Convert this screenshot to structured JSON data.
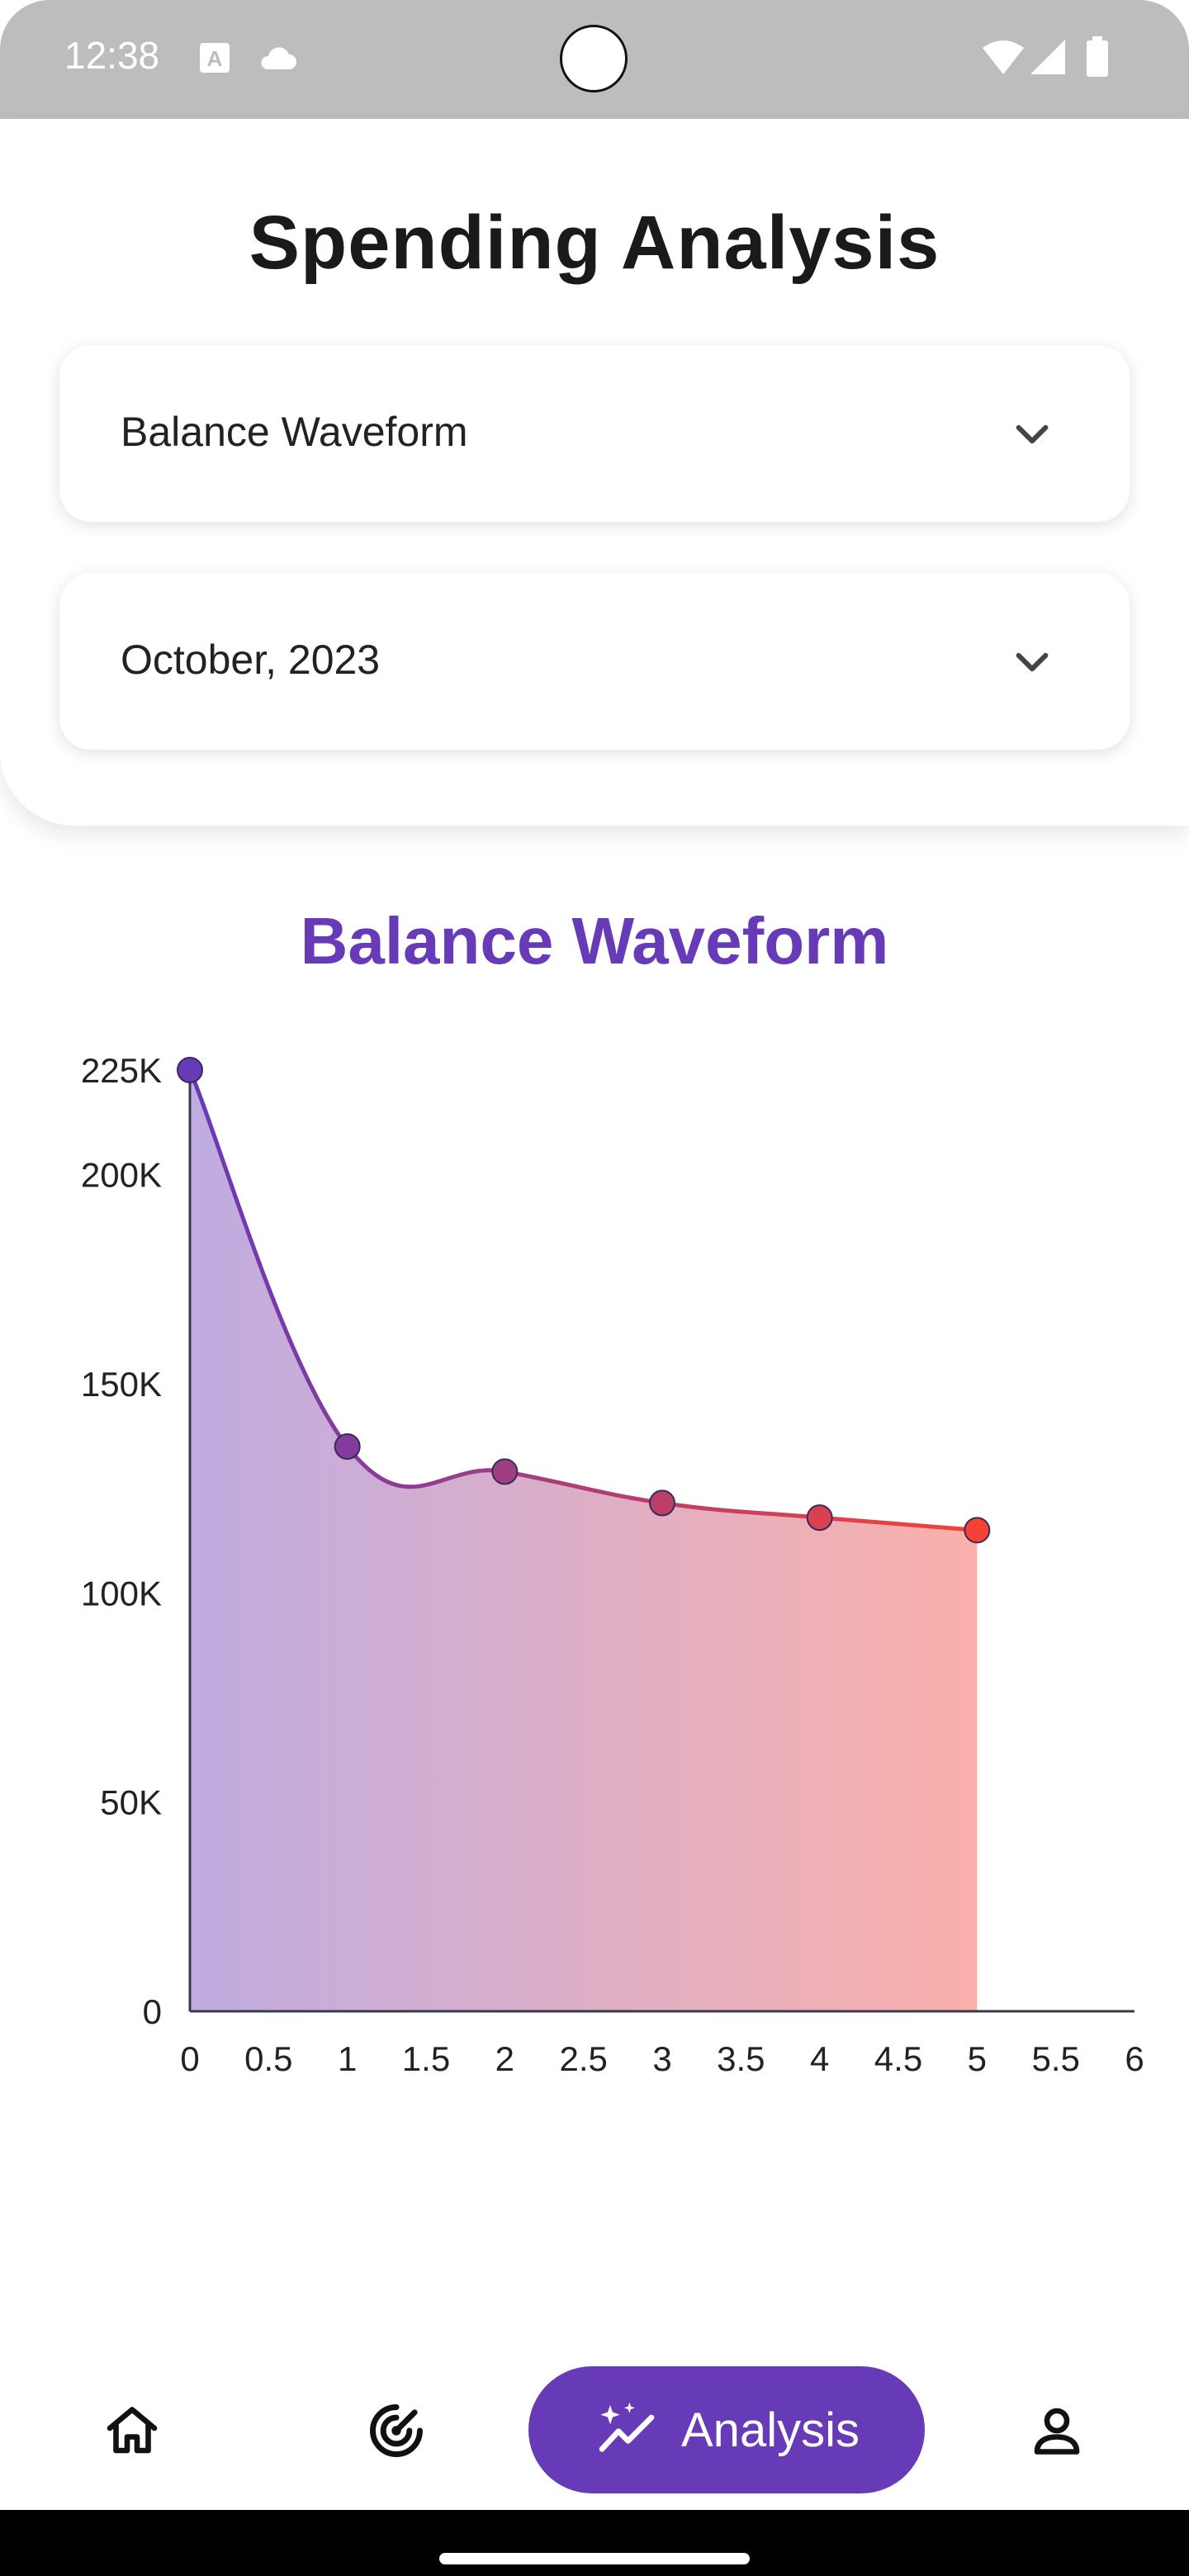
{
  "status_bar": {
    "time": "12:38"
  },
  "header": {
    "title": "Spending Analysis",
    "chart_type_dropdown": {
      "value": "Balance Waveform"
    },
    "month_dropdown": {
      "value": "October, 2023"
    }
  },
  "chart_data": {
    "type": "area",
    "title": "Balance Waveform",
    "xlabel": "",
    "ylabel": "",
    "x": [
      0,
      1,
      2,
      3,
      4,
      5
    ],
    "values": [
      225000,
      135000,
      129000,
      121500,
      118000,
      115000
    ],
    "xlim": [
      0,
      6
    ],
    "ylim": [
      0,
      225000
    ],
    "x_ticks": [
      0,
      0.5,
      1,
      1.5,
      2,
      2.5,
      3,
      3.5,
      4,
      4.5,
      5,
      5.5,
      6
    ],
    "x_tick_labels": [
      "0",
      "0.5",
      "1",
      "1.5",
      "2",
      "2.5",
      "3",
      "3.5",
      "4",
      "4.5",
      "5",
      "5.5",
      "6"
    ],
    "y_ticks": [
      0,
      50000,
      100000,
      150000,
      200000,
      225000
    ],
    "y_tick_labels": [
      "0",
      "50K",
      "100K",
      "150K",
      "200K",
      "225K"
    ],
    "gradient_colors": [
      "#673ab7",
      "#f44336"
    ],
    "grid": false,
    "legend": "none"
  },
  "bottom_nav": {
    "items": [
      {
        "icon": "home-icon"
      },
      {
        "icon": "radar-icon"
      },
      {
        "icon": "sparkle-chart-icon",
        "label": "Analysis",
        "active": true
      },
      {
        "icon": "person-icon"
      }
    ]
  },
  "colors": {
    "accent": "#673ab7",
    "status_bar": "#bdbdbd"
  }
}
